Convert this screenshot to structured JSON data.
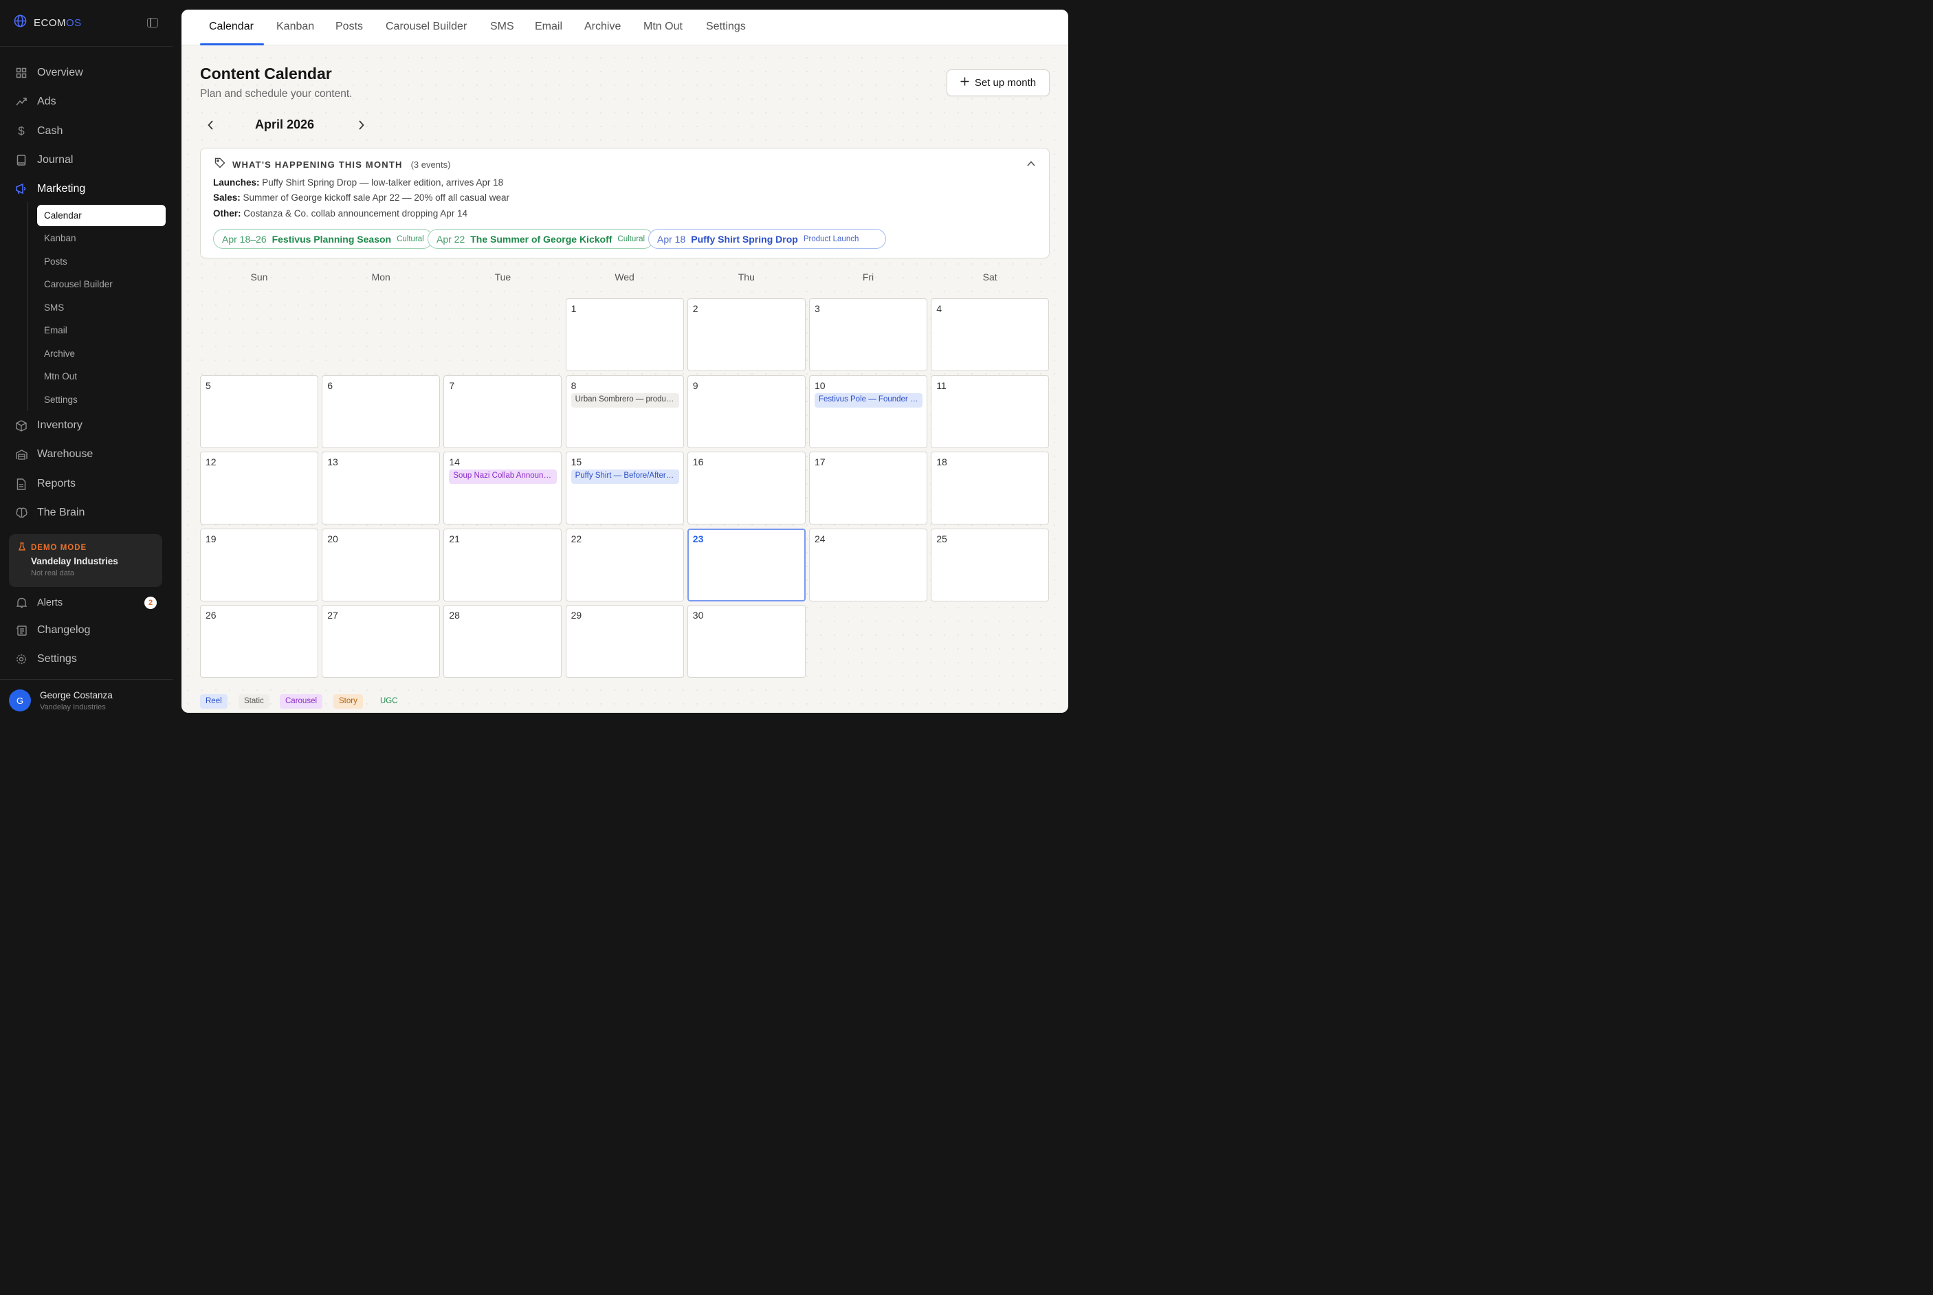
{
  "sidebar": {
    "brand": {
      "name_part1": "ECOM",
      "name_part2": "OS"
    },
    "nav": [
      {
        "label": "Overview",
        "icon": "grid-icon"
      },
      {
        "label": "Ads",
        "icon": "trend-up-icon"
      },
      {
        "label": "Cash",
        "icon": "dollar-icon"
      },
      {
        "label": "Journal",
        "icon": "book-icon"
      },
      {
        "label": "Marketing",
        "icon": "megaphone-icon",
        "active": true
      }
    ],
    "marketing_sub": [
      {
        "label": "Calendar",
        "active": true
      },
      {
        "label": "Kanban"
      },
      {
        "label": "Posts"
      },
      {
        "label": "Carousel Builder"
      },
      {
        "label": "SMS"
      },
      {
        "label": "Email"
      },
      {
        "label": "Archive"
      },
      {
        "label": "Mtn Out"
      },
      {
        "label": "Settings"
      }
    ],
    "nav_lower": [
      {
        "label": "Inventory",
        "icon": "box-icon"
      },
      {
        "label": "Warehouse",
        "icon": "warehouse-icon"
      },
      {
        "label": "Reports",
        "icon": "report-icon"
      },
      {
        "label": "The Brain",
        "icon": "brain-icon"
      }
    ],
    "demo": {
      "label": "DEMO MODE",
      "company": "Vandelay Industries",
      "note": "Not real data"
    },
    "alerts": {
      "label": "Alerts",
      "count": "2"
    },
    "changelog": "Changelog",
    "settings": "Settings",
    "user": {
      "initial": "G",
      "name": "George Costanza",
      "org": "Vandelay Industries"
    }
  },
  "tabs": [
    "Calendar",
    "Kanban",
    "Posts",
    "Carousel Builder",
    "SMS",
    "Email",
    "Archive",
    "Mtn Out",
    "Settings"
  ],
  "header": {
    "title": "Content Calendar",
    "subtitle": "Plan and schedule your content.",
    "setup_button": "Set up month"
  },
  "month": {
    "label": "April 2026"
  },
  "events": {
    "title": "WHAT'S HAPPENING THIS MONTH",
    "count": "(3 events)",
    "lines": [
      {
        "key": "Launches:",
        "text": "Puffy Shirt Spring Drop — low-talker edition, arrives Apr 18"
      },
      {
        "key": "Sales:",
        "text": "Summer of George kickoff sale Apr 22 — 20% off all casual wear"
      },
      {
        "key": "Other:",
        "text": "Costanza & Co. collab announcement dropping Apr 14"
      }
    ],
    "chips": [
      {
        "date": "Apr 18–26",
        "name": "Festivus Planning Season",
        "tag": "Cultural",
        "color": "green"
      },
      {
        "date": "Apr 22",
        "name": "The Summer of George Kickoff",
        "tag": "Cultural",
        "color": "green"
      },
      {
        "date": "Apr 18",
        "name": "Puffy Shirt Spring Drop",
        "tag": "Product Launch",
        "color": "blue"
      }
    ]
  },
  "weekdays": [
    "Sun",
    "Mon",
    "Tue",
    "Wed",
    "Thu",
    "Fri",
    "Sat"
  ],
  "calendar": {
    "first_weekday": 3,
    "days_in_month": 30,
    "today": 23,
    "posts": [
      {
        "day": 8,
        "text": "Urban Sombrero — product showcase",
        "type": "static"
      },
      {
        "day": 10,
        "text": "Festivus Pole — Founder interview",
        "type": "reel"
      },
      {
        "day": 14,
        "text": "Soup Nazi Collab Announcement",
        "type": "carousel"
      },
      {
        "day": 15,
        "text": "Puffy Shirt — Before/After reveal",
        "type": "reel"
      }
    ]
  },
  "legend": [
    {
      "label": "Reel",
      "type": "reel"
    },
    {
      "label": "Static",
      "type": "static"
    },
    {
      "label": "Carousel",
      "type": "carousel"
    },
    {
      "label": "Story",
      "type": "story"
    },
    {
      "label": "UGC",
      "type": "ugc"
    }
  ]
}
